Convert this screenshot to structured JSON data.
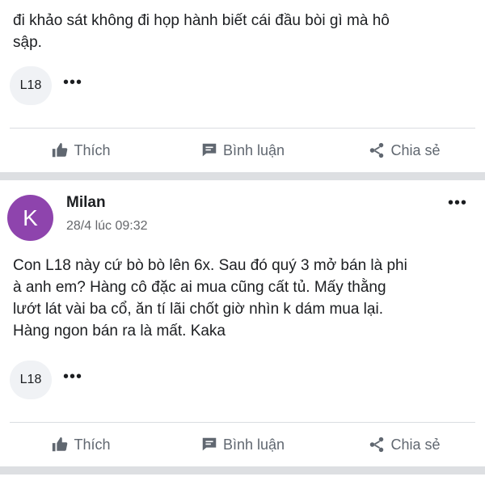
{
  "post1": {
    "text": "đi khảo sát không đi họp hành biết cái đầu bòi gì mà hô\nsập.",
    "tag": "L18",
    "more": "•••"
  },
  "actions": {
    "like": "Thích",
    "comment": "Bình luận",
    "share": "Chia sẻ"
  },
  "post2": {
    "avatar_letter": "K",
    "avatar_color": "#8e44ad",
    "author": "Milan",
    "timestamp": "28/4 lúc 09:32",
    "header_more": "•••",
    "text": "Con L18 này cứ bò bò lên 6x. Sau đó quý 3 mở bán là phi\nà anh em? Hàng cô đặc ai mua cũng cất tủ. Mấy thằng\nlướt lát vài ba cổ, ăn tí lãi chốt giờ nhìn k dám mua lại.\nHàng ngon bán ra là mất. Kaka",
    "tag": "L18",
    "more": "•••"
  },
  "icons": {
    "like": "thumbs-up-icon",
    "comment": "comment-icon",
    "share": "share-icon"
  }
}
